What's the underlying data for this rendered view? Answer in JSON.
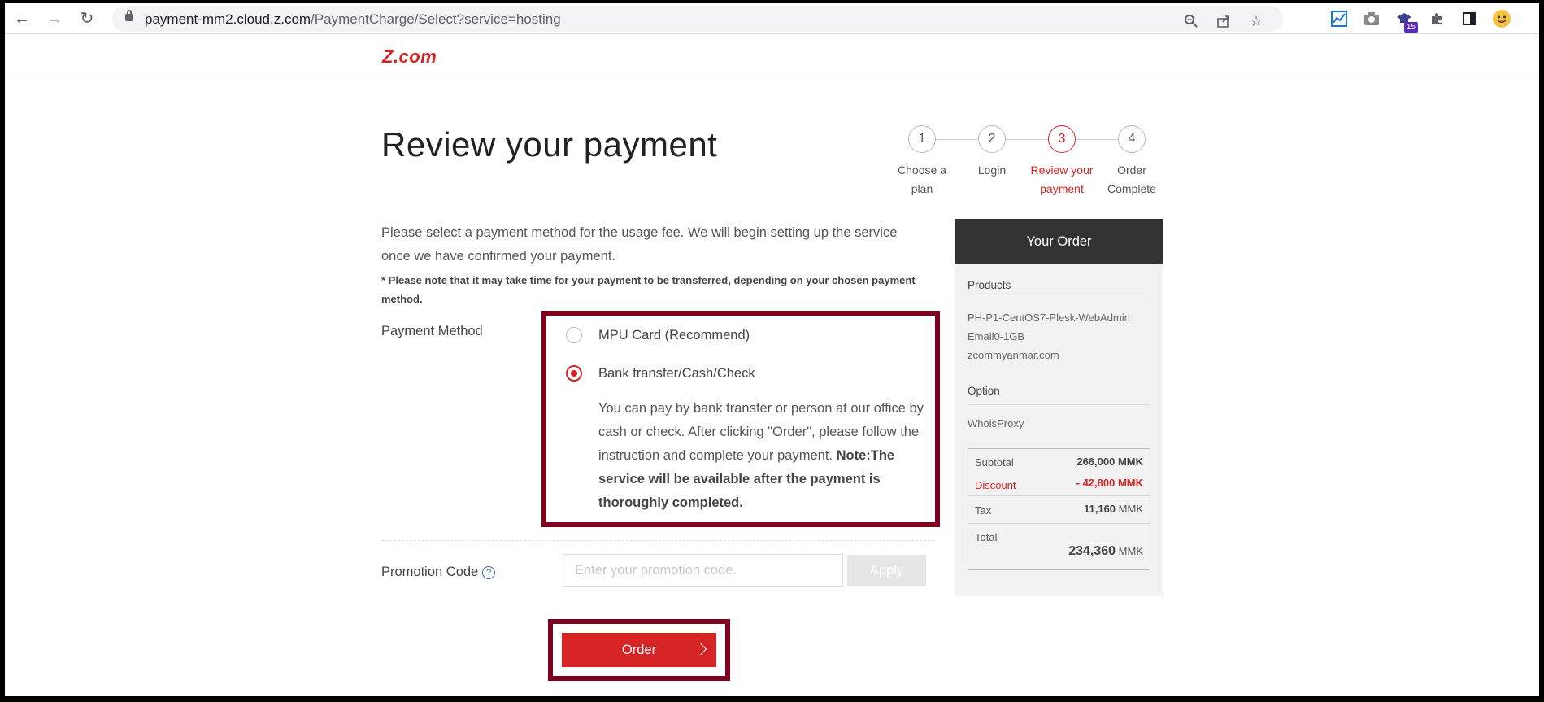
{
  "browser": {
    "url_host": "payment-mm2.cloud.z.com",
    "url_path": "/PaymentCharge/Select?service=hosting",
    "extension_badge": "15"
  },
  "site": {
    "logo_text": "Z.com"
  },
  "page": {
    "title": "Review your payment",
    "description": "Please select a payment method for the usage fee. We will begin setting up the service once we have confirmed your payment.",
    "note": "* Please note that it may take time for your payment to be transferred, depending on your chosen payment method."
  },
  "steps": [
    {
      "number": "1",
      "label": "Choose a plan",
      "active": false
    },
    {
      "number": "2",
      "label": "Login",
      "active": false
    },
    {
      "number": "3",
      "label": "Review your payment",
      "active": true
    },
    {
      "number": "4",
      "label": "Order Complete",
      "active": false
    }
  ],
  "payment": {
    "label": "Payment Method",
    "options": [
      {
        "label": "MPU Card (Recommend)",
        "selected": false
      },
      {
        "label": "Bank transfer/Cash/Check",
        "selected": true
      }
    ],
    "bank_info": "You can pay by bank transfer or person at our office by cash or check. After clicking \"Order\", please follow the instruction and complete your payment.",
    "bank_note": "Note:The service will be available after the payment is thoroughly completed."
  },
  "promo": {
    "label": "Promotion Code",
    "help_glyph": "?",
    "placeholder": "Enter your promotion code.",
    "apply_label": "Apply"
  },
  "order_button": {
    "label": "Order"
  },
  "order_summary": {
    "heading": "Your Order",
    "products_title": "Products",
    "product_name": "PH-P1-CentOS7-Plesk-WebAdmin Email0-1GB",
    "domain": "zcommyanmar.com",
    "option_title": "Option",
    "option_name": "WhoisProxy",
    "subtotal_label": "Subtotal",
    "subtotal_value": "266,000 MMK",
    "discount_label": "Discount",
    "discount_value": "- 42,800 MMK",
    "tax_label": "Tax",
    "tax_value": "11,160",
    "tax_unit": "MMK",
    "total_label": "Total",
    "total_value": "234,360",
    "total_unit": "MMK"
  },
  "colors": {
    "brand_red": "#d62323",
    "highlight_border": "#800020",
    "summary_header": "#333333"
  }
}
